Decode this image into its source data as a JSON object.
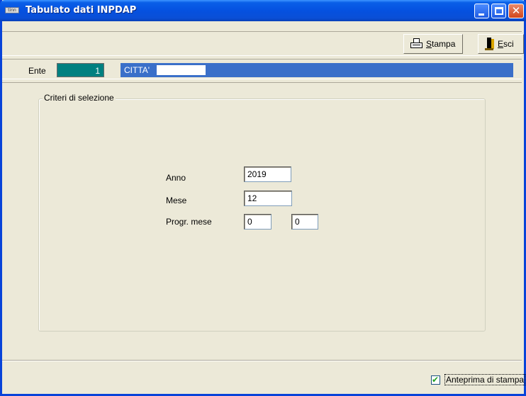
{
  "window": {
    "title": "Tabulato dati INPDAP",
    "app_icon_text": "tinn",
    "close_glyph": "✕"
  },
  "toolbar": {
    "stampa_accel": "S",
    "stampa_rest": "tampa",
    "esci_accel": "E",
    "esci_rest": "sci"
  },
  "ente": {
    "label": "Ente",
    "code": "1",
    "name": "CITTA'"
  },
  "criteria": {
    "group_title": "Criteri di selezione",
    "anno_label": "Anno",
    "anno_value": "2019",
    "mese_label": "Mese",
    "mese_value": "12",
    "progr_label": "Progr. mese",
    "progr_value_1": "0",
    "progr_value_2": "0"
  },
  "status": {
    "anteprima_label": "Anteprima di stampa",
    "anteprima_checked": true,
    "check_glyph": "✔"
  },
  "colors": {
    "titlebar": "#0551e0",
    "ente_code_bg": "#008080",
    "ente_name_bg": "#3a6fc9",
    "face": "#ece9d8"
  }
}
